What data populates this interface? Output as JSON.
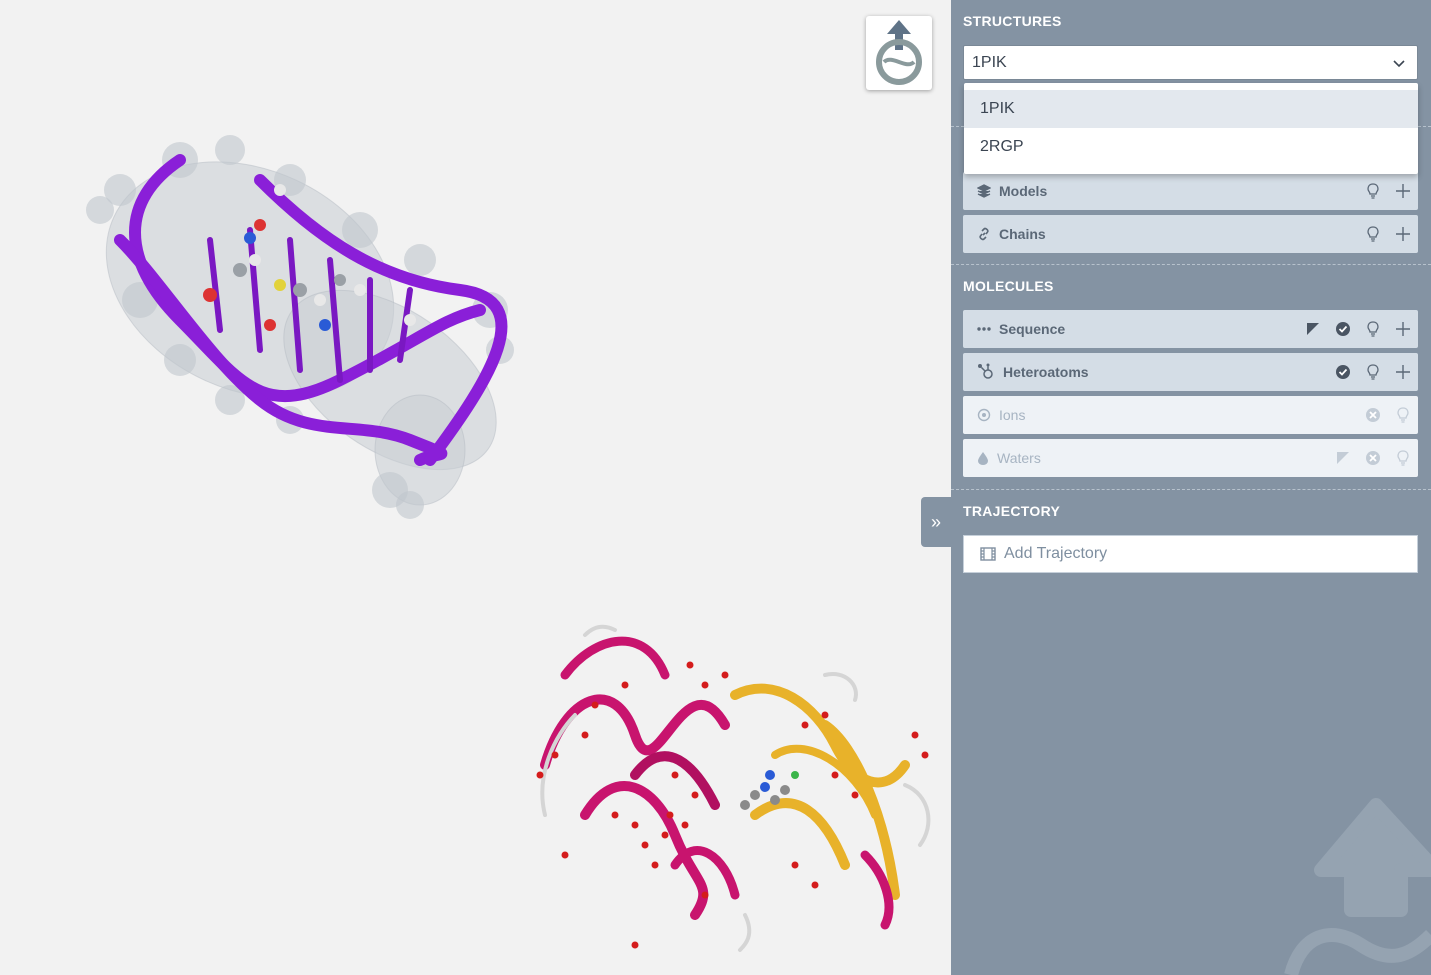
{
  "viewer": {
    "structures": [
      "dna-duplex",
      "protein"
    ]
  },
  "sidebar": {
    "structures": {
      "title": "STRUCTURES",
      "selected": "1PIK",
      "options": [
        "1PIK",
        "2RGP"
      ]
    },
    "rows_top": [
      {
        "label": "Models",
        "icon": "layers-icon"
      },
      {
        "label": "Chains",
        "icon": "link-icon"
      }
    ],
    "molecules": {
      "title": "MOLECULES",
      "items": [
        {
          "label": "Sequence",
          "icon": "ellipsis-icon",
          "enabled": true
        },
        {
          "label": "Heteroatoms",
          "icon": "molecule-icon",
          "enabled": true
        },
        {
          "label": "Ions",
          "icon": "ion-icon",
          "enabled": false
        },
        {
          "label": "Waters",
          "icon": "water-drop-icon",
          "enabled": false
        }
      ]
    },
    "trajectory": {
      "title": "TRAJECTORY",
      "add_label": "Add Trajectory"
    }
  },
  "colors": {
    "sidebar_bg": "#8493a3",
    "row_bg": "#d4dde6",
    "dna": "#8a1fd8",
    "helix_magenta": "#c8146e",
    "sheet_yellow": "#e8b22a"
  }
}
